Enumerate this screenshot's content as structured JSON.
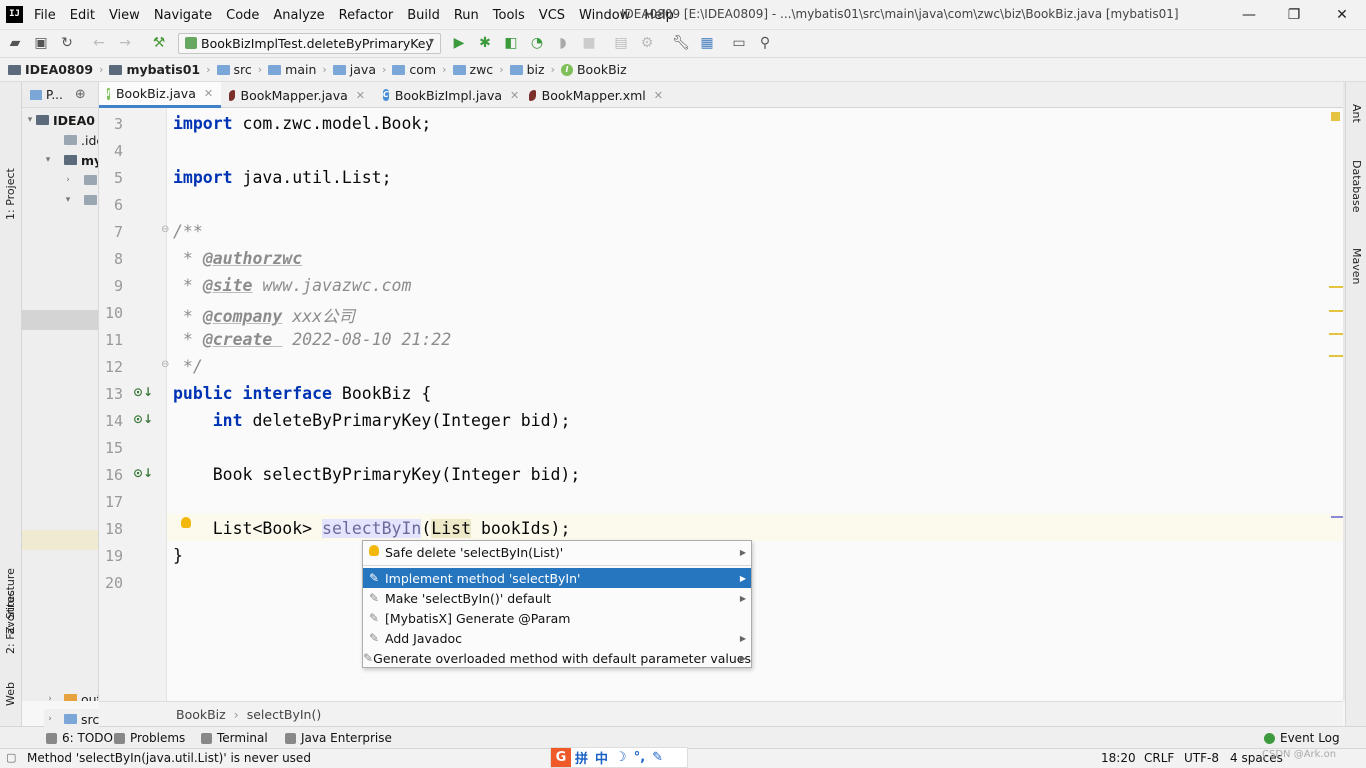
{
  "menu": {
    "items": [
      "File",
      "Edit",
      "View",
      "Navigate",
      "Code",
      "Analyze",
      "Refactor",
      "Build",
      "Run",
      "Tools",
      "VCS",
      "Window",
      "Help"
    ],
    "app_logo": "IJ",
    "window_title": "IDEA0809 [E:\\IDEA0809] - ...\\mybatis01\\src\\main\\java\\com\\zwc\\biz\\BookBiz.java [mybatis01]"
  },
  "toolbar": {
    "run_config": "BookBizImplTest.deleteByPrimaryKey",
    "icons": [
      "open-icon",
      "save-icon",
      "sync-icon",
      "back-icon",
      "forward-icon",
      "build-icon",
      "run-icon",
      "debug-icon",
      "coverage-icon",
      "profile-icon",
      "attach-icon",
      "stop-icon",
      "rebuild-icon",
      "tools-icon",
      "wrench-icon",
      "structure-icon",
      "terminal-icon",
      "search-icon"
    ]
  },
  "breadcrumb": [
    "IDEA0809",
    "mybatis01",
    "src",
    "main",
    "java",
    "com",
    "zwc",
    "biz",
    "BookBiz"
  ],
  "left_strip": {
    "project": "1: Project",
    "structure": "Z: Structure",
    "favorites": "2: Favorites",
    "web": "Web"
  },
  "project_panel": {
    "header": "P...",
    "tree": [
      {
        "label": "IDEA0",
        "indent": 0,
        "arrow": "▾"
      },
      {
        "label": ".ide",
        "indent": 2,
        "arrow": "›"
      },
      {
        "label": "my",
        "indent": 2,
        "arrow": "▾"
      },
      {
        "label": "",
        "indent": 3,
        "arrow": "›"
      },
      {
        "label": "",
        "indent": 3,
        "arrow": "▾"
      },
      {
        "label": "out",
        "indent": 2,
        "arrow": "›"
      },
      {
        "label": "src",
        "indent": 2,
        "arrow": "›"
      }
    ]
  },
  "tabs": [
    {
      "label": "BookBiz.java",
      "icon": "interface",
      "active": true
    },
    {
      "label": "BookMapper.java",
      "icon": "mybatis",
      "active": false
    },
    {
      "label": "BookBizImpl.java",
      "icon": "class",
      "active": false
    },
    {
      "label": "BookMapper.xml",
      "icon": "mybatis",
      "active": false
    }
  ],
  "code": {
    "line_numbers": [
      "3",
      "4",
      "5",
      "6",
      "7",
      "8",
      "9",
      "10",
      "11",
      "12",
      "13",
      "14",
      "15",
      "16",
      "17",
      "18",
      "19",
      "20"
    ],
    "l3_kw": "import",
    "l3_rest": " com.zwc.model.Book;",
    "l5_kw": "import",
    "l5_rest": " java.util.List;",
    "l7": "/**",
    "l8_pre": " * ",
    "l8_tag": "@authorzwc",
    "l9_pre": " * ",
    "l9_tag": "@site",
    "l9_rest": " www.javazwc.com",
    "l10_pre": " * ",
    "l10_tag": "@company",
    "l10_rest": " xxx公司",
    "l11_pre": " * ",
    "l11_tag": "@create ",
    "l11_rest": " 2022-08-10 21:22",
    "l12": " */",
    "l13_kw1": "public",
    "l13_kw2": "interface",
    "l13_rest": " BookBiz {",
    "l14_kw": "int",
    "l14_rest": " deleteByPrimaryKey(Integer bid);",
    "l16": "    Book selectByPrimaryKey(Integer bid);",
    "l18_pre": "    List<Book> ",
    "l18_method": "selectByIn",
    "l18_paren": "(",
    "l18_type": "List",
    "l18_rest": " bookIds);",
    "l19": "}"
  },
  "popup": {
    "items": [
      {
        "label": "Safe delete 'selectByIn(List)'",
        "icon": "bulb",
        "submenu": true,
        "selected": false
      },
      {
        "label": "Implement method 'selectByIn'",
        "icon": "pencil",
        "submenu": true,
        "selected": true
      },
      {
        "label": "Make 'selectByIn()' default",
        "icon": "pencil",
        "submenu": true,
        "selected": false
      },
      {
        "label": "[MybatisX] Generate @Param",
        "icon": "pencil",
        "submenu": false,
        "selected": false
      },
      {
        "label": "Add Javadoc",
        "icon": "pencil",
        "submenu": true,
        "selected": false
      },
      {
        "label": "Generate overloaded method with default parameter values",
        "icon": "pencil",
        "submenu": true,
        "selected": false
      }
    ]
  },
  "editor_crumbs": [
    "BookBiz",
    "selectByIn()"
  ],
  "right_strip": [
    "Ant",
    "Database",
    "Maven"
  ],
  "bottom_tools": [
    "6: TODO",
    "Problems",
    "Terminal",
    "Java Enterprise",
    "Event Log"
  ],
  "status": {
    "message": "Method 'selectByIn(java.util.List)' is never used",
    "position": "18:20",
    "line_sep": "CRLF",
    "encoding": "UTF-8",
    "indent": "4 spaces",
    "watermark": "CSDN @Ark.on"
  },
  "ime": {
    "logo": "G",
    "glyphs": [
      "拼",
      "中",
      "☽",
      "°,",
      "✎"
    ]
  },
  "colors": {
    "accent": "#2675bf",
    "keyword": "#0033b3",
    "comment": "#8c8c8c"
  }
}
